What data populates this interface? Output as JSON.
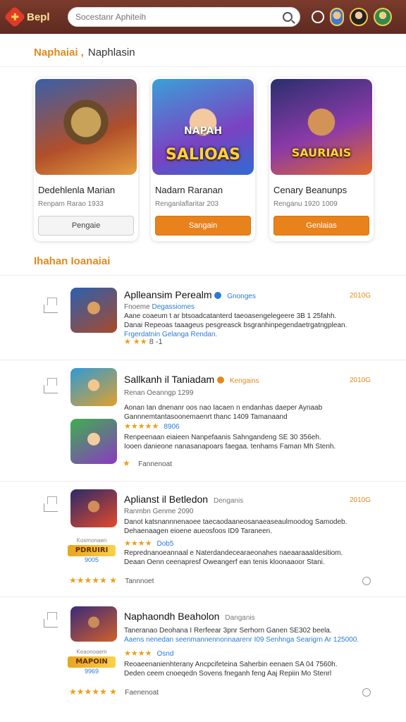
{
  "header": {
    "logo_text": "Bepl",
    "logo_glyph": "✚",
    "search_placeholder": "Socestanr Aphiteih",
    "icons": [
      "search-icon",
      "bell-icon",
      "avatar-icon"
    ]
  },
  "featured": {
    "heading_a": "Naphaiai ,",
    "heading_b": "Naphlasin",
    "cards": [
      {
        "art_top": "",
        "art_label": "",
        "title": "Dedehlenla Marian",
        "meta": "Renpam  Rarao 1933",
        "button": "Pengaie",
        "button_style": "grey"
      },
      {
        "art_top": "NAPAH",
        "art_label": "SALIOAS",
        "title": "Nadarn Raranan",
        "meta": "Renganlaflaritar 203",
        "button": "Sangain",
        "button_style": "orange"
      },
      {
        "art_top": "",
        "art_label": "SAURIAIS",
        "title": "Cenary Beanunps",
        "meta": "Renganu 1920 1009",
        "button": "Genlaias",
        "button_style": "orange"
      }
    ]
  },
  "list": {
    "heading": "Ihahan Ioanaiai",
    "items": [
      {
        "title": "Aplleansim Perealm",
        "badge": "Gnonges",
        "date": "2010G",
        "sub_a": "Fnoeme",
        "sub_b": "Degassiomes",
        "desc": [
          "Aane coaeum  t ar btsoadcatanterd taeoasengelegeere  3B 1 25fahh.",
          "Danai Repeoas  taaageus pesgreasck  bsgranhinpegendaetrgatngplean.",
          "Frgerdatnin  Gelanga  Rendan."
        ],
        "stars": "★ ★★",
        "stars_extra": "8 -1"
      },
      {
        "title": "Sallkanh il Taniadam",
        "badge": "Kengains",
        "date": "2010G",
        "sub": "Renan  Oeanngp 1299",
        "desc": [
          "Aonan Ian  dnenanr oos nao Iacaen n endanhas  daeper  Aynaab",
          "Gannnemtantasoonemaenrt  thanc 1409  Tamanaand"
        ],
        "mini_stars": "★★★★★",
        "mini_num": "8906",
        "desc2": [
          "Renpeenaan  eiaieen   Nanpefaanis  Sahngandeng  SE 30 356eh.",
          "Iooen  danieone  nanasanapoars  faegaa.  tenhams  Faman Mh Stenh."
        ],
        "star_label": "Fannenoat"
      },
      {
        "title": "Aplianst il Betledon",
        "badge": "Denganis",
        "date": "2010G",
        "sub": "Ranmbn  Genme 2090",
        "desc": [
          "Danot katsnannnenaoee  taecaodaaneosanaeaseaulmoodog  Samodeb.",
          "Dehaenaagen  eioene  aueosfoos  ID9  Taraneen."
        ],
        "promo_top": "Kosmonaen",
        "promo_banner": "PDRUIRI",
        "promo_num": "9005",
        "mini_stars": "★★★★",
        "mini_num": "Dob5",
        "desc2": [
          "Reprednanoeannaal  e Naterdandecearaeonahes  naeaaraaaldesitiom.",
          "Deaan  Oenn  ceenapresf  Oweangerf  ean  tenis  kloonaaoor Stani."
        ],
        "stars_big": "★★★★★",
        "star_label": "Tannnoet"
      },
      {
        "title": "Naphaondh Beaholon",
        "badge": "Danganis",
        "sub": "Taneranao  Deohana  I Rerfeear  3pnr  Serhorn  Ganen  SE302 beela.",
        "desc": [
          "Aaens  nenedan  seenmannennonnaarenr  I09  Senhnga  Searigrn  Ar 125000."
        ],
        "promo_top": "Keaonoaem",
        "promo_banner": "MAPOIN",
        "promo_num": "9969",
        "mini_stars": "★★★★",
        "mini_num": "Osnd",
        "desc2": [
          "Reoaeenanienhterany  Ancpcifeteina  Saherbin  eenaen  SA 04 7560h.",
          "Deden  ceem  cnoeqedn  Sovens  fneganh  feng  Aaj  Repiin  Mo  Stenrl"
        ],
        "stars_big": "★★★★★",
        "star_label": "Faenenoat"
      }
    ]
  }
}
